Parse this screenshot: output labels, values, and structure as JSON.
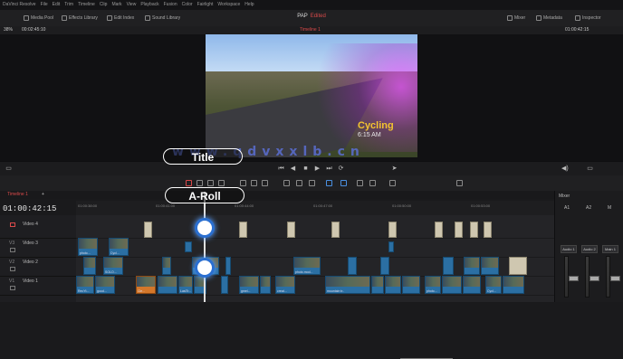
{
  "menu": [
    "DaVinci Resolve",
    "File",
    "Edit",
    "Trim",
    "Timeline",
    "Clip",
    "Mark",
    "View",
    "Playback",
    "Fusion",
    "Color",
    "Fairlight",
    "Workspace",
    "Help"
  ],
  "toolbar": {
    "left": [
      "Media Pool",
      "Effects Library",
      "Edit Index",
      "Sound Library"
    ],
    "project": "PAP",
    "edited": "Edited",
    "right": [
      "Mixer",
      "Metadata",
      "Inspector"
    ]
  },
  "viewer": {
    "zoom": "38%",
    "source_tc": "00:02:45:10",
    "timeline_name": "Timeline 1",
    "record_tc": "01:00:42:15",
    "overlay_title": "Cycling",
    "overlay_time": "6:15 AM",
    "watermark": "www.qdvxxlb.cn"
  },
  "timeline": {
    "tab": "Timeline 1",
    "timecode": "01:00:42:15",
    "ruler": [
      "01:00:38:00",
      "01:00:41:00",
      "01:00:44:00",
      "01:00:47:00",
      "01:00:50:00",
      "01:00:53:00",
      "01:00:56:00"
    ],
    "tracks": [
      {
        "id": "",
        "name": "Video 4"
      },
      {
        "id": "V3",
        "name": "Video 3"
      },
      {
        "id": "V2",
        "name": "Video 2"
      },
      {
        "id": "V1",
        "name": "Video 1"
      }
    ],
    "clip_labels": {
      "a": "photo...",
      "b": "Cycl...",
      "c": "SOLO...",
      "d": "RecYt...",
      "e": "good...",
      "f": "Cle...",
      "g": "photo.mod...",
      "h": "LaslTr...",
      "i": "gmel...",
      "j": "creat...",
      "k": "mountain tr..",
      "l": "photo...",
      "m": "Cycl..."
    }
  },
  "callouts": {
    "title": "Title",
    "aroll": "A-Roll"
  },
  "mixer": {
    "title": "Mixer",
    "channels": [
      "A1",
      "A2",
      "M"
    ],
    "buses": [
      "Audio 1",
      "Audio 2",
      "Main 1"
    ]
  }
}
